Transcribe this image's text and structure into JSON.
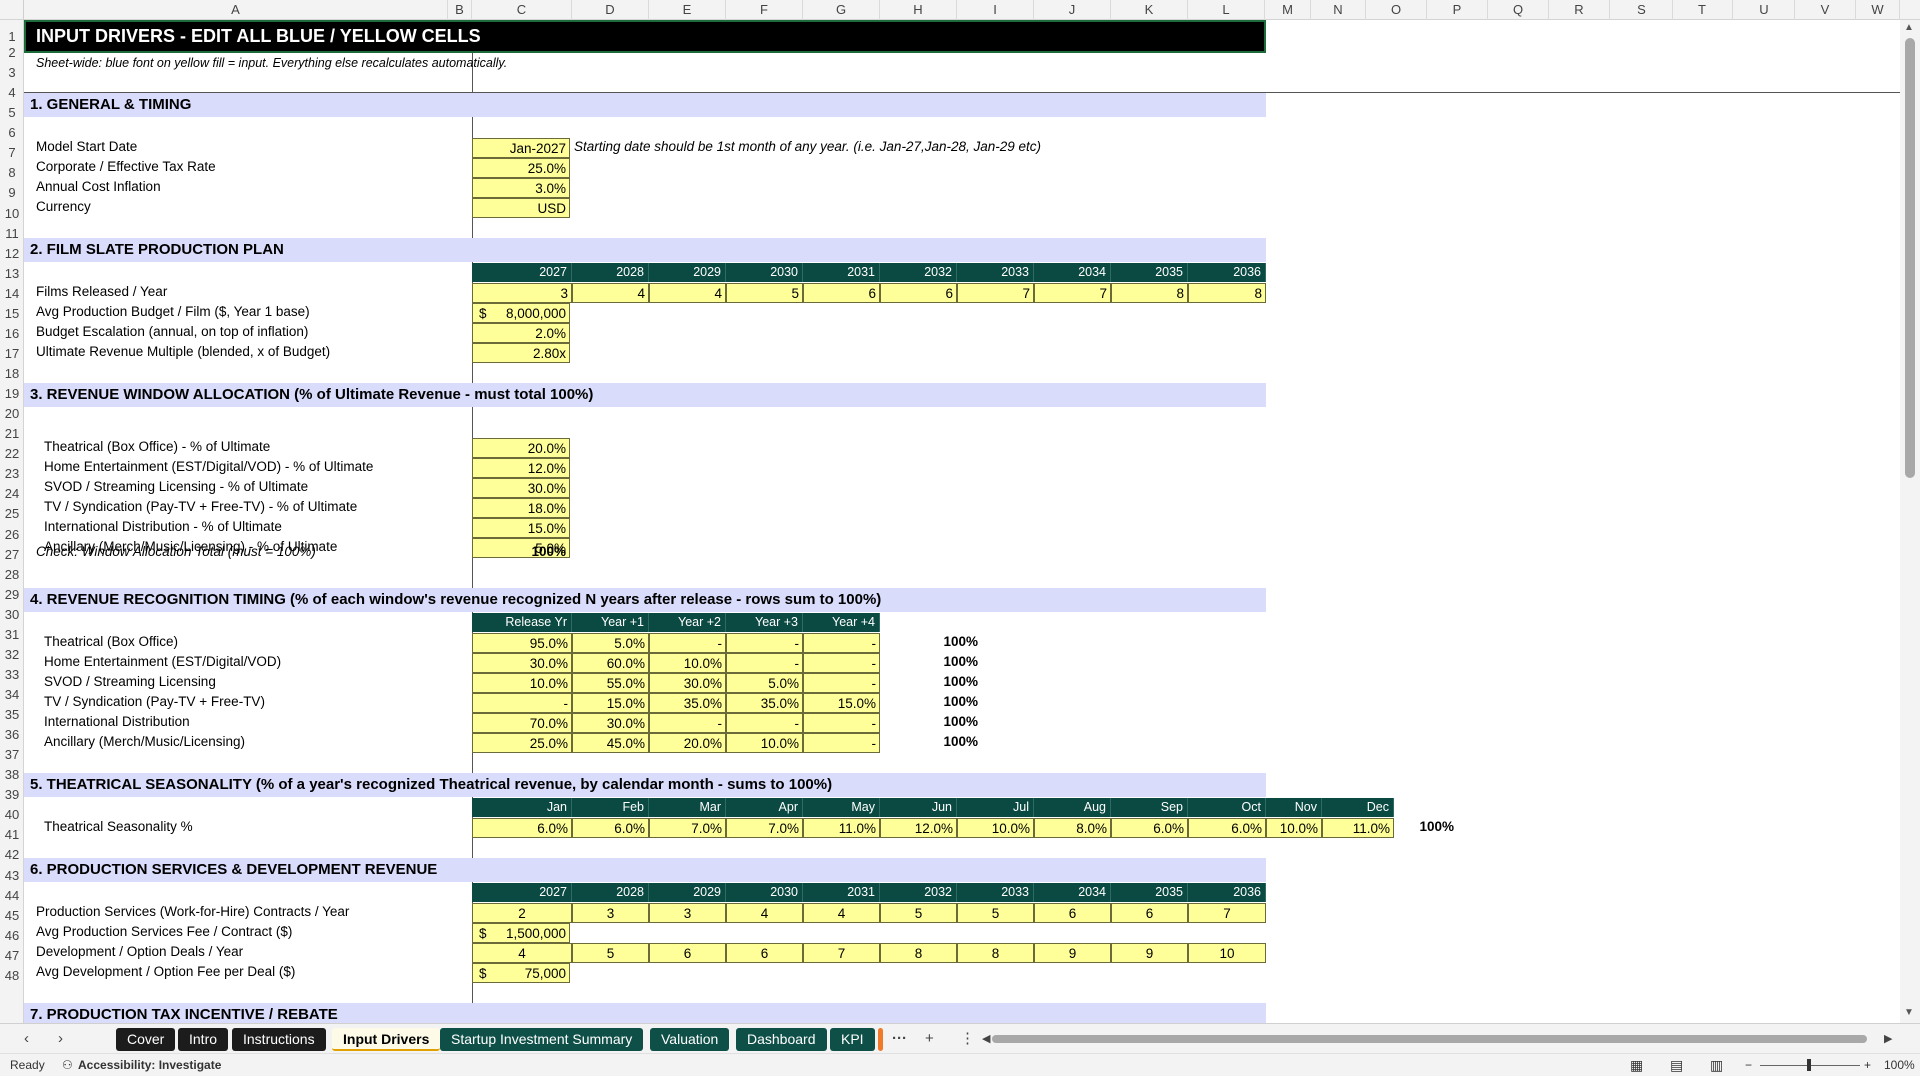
{
  "columns": [
    "A",
    "B",
    "C",
    "D",
    "E",
    "F",
    "G",
    "H",
    "I",
    "J",
    "K",
    "L",
    "M",
    "N",
    "O",
    "P",
    "Q",
    "R",
    "S",
    "T",
    "U",
    "V",
    "W"
  ],
  "rows": [
    "1",
    "2",
    "3",
    "4",
    "5",
    "6",
    "7",
    "8",
    "9",
    "10",
    "11",
    "12",
    "13",
    "14",
    "15",
    "16",
    "17",
    "18",
    "19",
    "20",
    "21",
    "22",
    "23",
    "24",
    "25",
    "26",
    "27",
    "28",
    "29",
    "30",
    "31",
    "32",
    "33",
    "34",
    "35",
    "36",
    "37",
    "38",
    "39",
    "40",
    "41",
    "42",
    "43",
    "44",
    "45",
    "46",
    "47",
    "48"
  ],
  "title": "INPUT DRIVERS - EDIT ALL BLUE / YELLOW CELLS",
  "subtitle": "Sheet-wide: blue font on yellow fill = input. Everything else recalculates automatically.",
  "s1": {
    "heading": "1.  GENERAL & TIMING",
    "start_label": "Model Start Date",
    "start_value": "Jan-2027",
    "start_note": "Starting date should be 1st month of any year. (i.e. Jan-27,Jan-28, Jan-29 etc)",
    "tax_label": "Corporate / Effective Tax Rate",
    "tax_value": "25.0%",
    "infl_label": "Annual Cost Inflation",
    "infl_value": "3.0%",
    "cur_label": "Currency",
    "cur_value": "USD"
  },
  "s2": {
    "heading": "2.  FILM SLATE PRODUCTION PLAN",
    "years": [
      "2027",
      "2028",
      "2029",
      "2030",
      "2031",
      "2032",
      "2033",
      "2034",
      "2035",
      "2036"
    ],
    "films_label": "Films Released / Year",
    "films": [
      "3",
      "4",
      "4",
      "5",
      "6",
      "6",
      "7",
      "7",
      "8",
      "8"
    ],
    "budget_label": "Avg Production Budget / Film ($, Year 1 base)",
    "budget_cur": "$",
    "budget_value": "8,000,000",
    "escal_label": "Budget Escalation (annual, on top of inflation)",
    "escal_value": "2.0%",
    "mult_label": "Ultimate Revenue Multiple (blended, x of Budget)",
    "mult_value": "2.80x"
  },
  "s3": {
    "heading": "3.  REVENUE WINDOW ALLOCATION  (% of Ultimate Revenue - must total 100%)",
    "items": [
      {
        "label": "Theatrical (Box Office) - % of Ultimate",
        "value": "20.0%"
      },
      {
        "label": "Home Entertainment (EST/Digital/VOD) - % of Ultimate",
        "value": "12.0%"
      },
      {
        "label": "SVOD / Streaming Licensing - % of Ultimate",
        "value": "30.0%"
      },
      {
        "label": "TV / Syndication (Pay-TV + Free-TV) - % of Ultimate",
        "value": "18.0%"
      },
      {
        "label": "International Distribution - % of Ultimate",
        "value": "15.0%"
      },
      {
        "label": "Ancillary (Merch/Music/Licensing) - % of Ultimate",
        "value": "5.0%"
      }
    ],
    "check_label": "Check: Window Allocation Total (must = 100%)",
    "check_value": "100%"
  },
  "s4": {
    "heading": "4.  REVENUE RECOGNITION TIMING  (% of each window's revenue recognized N years after release - rows sum to 100%)",
    "headers": [
      "Release Yr",
      "Year +1",
      "Year +2",
      "Year +3",
      "Year +4"
    ],
    "rows": [
      {
        "label": "Theatrical (Box Office)",
        "values": [
          "95.0%",
          "5.0%",
          "-",
          "-",
          "-"
        ],
        "total": "100%"
      },
      {
        "label": "Home Entertainment (EST/Digital/VOD)",
        "values": [
          "30.0%",
          "60.0%",
          "10.0%",
          "-",
          "-"
        ],
        "total": "100%"
      },
      {
        "label": "SVOD / Streaming Licensing",
        "values": [
          "10.0%",
          "55.0%",
          "30.0%",
          "5.0%",
          "-"
        ],
        "total": "100%"
      },
      {
        "label": "TV / Syndication (Pay-TV + Free-TV)",
        "values": [
          "-",
          "15.0%",
          "35.0%",
          "35.0%",
          "15.0%"
        ],
        "total": "100%"
      },
      {
        "label": "International Distribution",
        "values": [
          "70.0%",
          "30.0%",
          "-",
          "-",
          "-"
        ],
        "total": "100%"
      },
      {
        "label": "Ancillary (Merch/Music/Licensing)",
        "values": [
          "25.0%",
          "45.0%",
          "20.0%",
          "10.0%",
          "-"
        ],
        "total": "100%"
      }
    ]
  },
  "s5": {
    "heading": "5.  THEATRICAL SEASONALITY  (% of a year's recognized Theatrical revenue, by calendar month - sums to 100%)",
    "months": [
      "Jan",
      "Feb",
      "Mar",
      "Apr",
      "May",
      "Jun",
      "Jul",
      "Aug",
      "Sep",
      "Oct",
      "Nov",
      "Dec"
    ],
    "label": "Theatrical Seasonality %",
    "values": [
      "6.0%",
      "6.0%",
      "7.0%",
      "7.0%",
      "11.0%",
      "12.0%",
      "10.0%",
      "8.0%",
      "6.0%",
      "6.0%",
      "10.0%",
      "11.0%"
    ],
    "total": "100%"
  },
  "s6": {
    "heading": "6.  PRODUCTION SERVICES & DEVELOPMENT REVENUE",
    "years": [
      "2027",
      "2028",
      "2029",
      "2030",
      "2031",
      "2032",
      "2033",
      "2034",
      "2035",
      "2036"
    ],
    "contracts_label": "Production Services (Work-for-Hire) Contracts / Year",
    "contracts": [
      "2",
      "3",
      "3",
      "4",
      "4",
      "5",
      "5",
      "6",
      "6",
      "7"
    ],
    "fee_label": "Avg Production Services Fee / Contract ($)",
    "fee_cur": "$",
    "fee_value": "1,500,000",
    "deals_label": "Development / Option Deals / Year",
    "deals": [
      "4",
      "5",
      "6",
      "6",
      "7",
      "8",
      "8",
      "9",
      "9",
      "10"
    ],
    "dfee_label": "Avg Development / Option Fee per Deal ($)",
    "dfee_cur": "$",
    "dfee_value": "75,000"
  },
  "s7": {
    "heading": "7.  PRODUCTION TAX INCENTIVE / REBATE"
  },
  "tabs": [
    "Cover",
    "Intro",
    "Instructions",
    "Input Drivers",
    "Startup Investment Summary",
    "Valuation",
    "Dashboard",
    "KPI"
  ],
  "tab_more": "···",
  "tab_add": "+",
  "tab_menu": "⋮",
  "status": {
    "ready": "Ready",
    "accessibility": "Accessibility: Investigate",
    "zoom": "100%"
  },
  "colors": {
    "input_fill": "#ffff99",
    "header_teal": "#0b4a42",
    "section_fill": "#d9dcfb",
    "title_fill": "#000000"
  }
}
